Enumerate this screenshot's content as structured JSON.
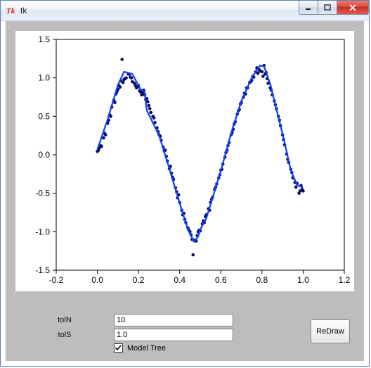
{
  "window": {
    "title": "tk",
    "icon_label": "Tk"
  },
  "controls": {
    "tolN_label": "tolN",
    "tolN_value": "10",
    "tolS_label": "tolS",
    "tolS_value": "1.0",
    "redraw_label": "ReDraw",
    "model_tree_label": "Model Tree",
    "model_tree_checked": true
  },
  "chart_data": {
    "type": "scatter+line",
    "xlabel": "",
    "ylabel": "",
    "xlim": [
      -0.2,
      1.2
    ],
    "ylim": [
      -1.5,
      1.5
    ],
    "xticks": [
      -0.2,
      0.0,
      0.2,
      0.4,
      0.6,
      0.8,
      1.0,
      1.2
    ],
    "yticks": [
      -1.5,
      -1.0,
      -0.5,
      0.0,
      0.5,
      1.0,
      1.5
    ],
    "series": [
      {
        "name": "data",
        "type": "scatter",
        "color": "#0a0a60",
        "points": [
          [
            0.0,
            0.045
          ],
          [
            0.005,
            0.06
          ],
          [
            0.01,
            0.09
          ],
          [
            0.015,
            0.12
          ],
          [
            0.02,
            0.11
          ],
          [
            0.03,
            0.22
          ],
          [
            0.035,
            0.28
          ],
          [
            0.04,
            0.26
          ],
          [
            0.05,
            0.41
          ],
          [
            0.055,
            0.45
          ],
          [
            0.06,
            0.52
          ],
          [
            0.065,
            0.5
          ],
          [
            0.07,
            0.62
          ],
          [
            0.08,
            0.71
          ],
          [
            0.085,
            0.68
          ],
          [
            0.09,
            0.79
          ],
          [
            0.095,
            0.82
          ],
          [
            0.1,
            0.85
          ],
          [
            0.105,
            0.9
          ],
          [
            0.11,
            0.88
          ],
          [
            0.115,
            0.96
          ],
          [
            0.12,
            1.24
          ],
          [
            0.125,
            0.94
          ],
          [
            0.13,
            0.98
          ],
          [
            0.135,
            0.99
          ],
          [
            0.14,
            1.0
          ],
          [
            0.15,
            1.05
          ],
          [
            0.155,
            1.05
          ],
          [
            0.16,
            1.01
          ],
          [
            0.165,
            1.0
          ],
          [
            0.17,
            0.95
          ],
          [
            0.18,
            0.93
          ],
          [
            0.185,
            0.9
          ],
          [
            0.19,
            0.87
          ],
          [
            0.195,
            0.88
          ],
          [
            0.2,
            0.9
          ],
          [
            0.205,
            0.83
          ],
          [
            0.21,
            0.82
          ],
          [
            0.215,
            0.78
          ],
          [
            0.22,
            0.81
          ],
          [
            0.225,
            0.84
          ],
          [
            0.23,
            0.78
          ],
          [
            0.235,
            0.72
          ],
          [
            0.24,
            0.73
          ],
          [
            0.245,
            0.69
          ],
          [
            0.25,
            0.64
          ],
          [
            0.255,
            0.6
          ],
          [
            0.26,
            0.55
          ],
          [
            0.27,
            0.5
          ],
          [
            0.275,
            0.48
          ],
          [
            0.28,
            0.42
          ],
          [
            0.29,
            0.35
          ],
          [
            0.295,
            0.3
          ],
          [
            0.3,
            0.26
          ],
          [
            0.305,
            0.24
          ],
          [
            0.31,
            0.19
          ],
          [
            0.32,
            0.1
          ],
          [
            0.325,
            0.05
          ],
          [
            0.33,
            0.06
          ],
          [
            0.335,
            -0.02
          ],
          [
            0.34,
            -0.08
          ],
          [
            0.35,
            -0.18
          ],
          [
            0.355,
            -0.15
          ],
          [
            0.36,
            -0.24
          ],
          [
            0.365,
            -0.29
          ],
          [
            0.37,
            -0.32
          ],
          [
            0.38,
            -0.43
          ],
          [
            0.385,
            -0.48
          ],
          [
            0.39,
            -0.56
          ],
          [
            0.395,
            -0.52
          ],
          [
            0.4,
            -0.62
          ],
          [
            0.41,
            -0.72
          ],
          [
            0.415,
            -0.78
          ],
          [
            0.42,
            -0.76
          ],
          [
            0.425,
            -0.84
          ],
          [
            0.43,
            -0.88
          ],
          [
            0.44,
            -0.95
          ],
          [
            0.445,
            -0.98
          ],
          [
            0.45,
            -1.0
          ],
          [
            0.455,
            -1.04
          ],
          [
            0.46,
            -1.1
          ],
          [
            0.465,
            -1.3
          ],
          [
            0.47,
            -1.11
          ],
          [
            0.48,
            -1.12
          ],
          [
            0.485,
            -1.05
          ],
          [
            0.49,
            -1.0
          ],
          [
            0.495,
            -0.98
          ],
          [
            0.5,
            -0.99
          ],
          [
            0.51,
            -0.9
          ],
          [
            0.515,
            -0.86
          ],
          [
            0.52,
            -0.88
          ],
          [
            0.525,
            -0.8
          ],
          [
            0.53,
            -0.78
          ],
          [
            0.54,
            -0.7
          ],
          [
            0.545,
            -0.72
          ],
          [
            0.55,
            -0.62
          ],
          [
            0.555,
            -0.58
          ],
          [
            0.56,
            -0.55
          ],
          [
            0.57,
            -0.45
          ],
          [
            0.575,
            -0.42
          ],
          [
            0.58,
            -0.38
          ],
          [
            0.59,
            -0.3
          ],
          [
            0.595,
            -0.26
          ],
          [
            0.6,
            -0.2
          ],
          [
            0.605,
            -0.19
          ],
          [
            0.61,
            -0.12
          ],
          [
            0.62,
            -0.03
          ],
          [
            0.625,
            0.03
          ],
          [
            0.63,
            0.06
          ],
          [
            0.635,
            0.12
          ],
          [
            0.64,
            0.16
          ],
          [
            0.65,
            0.26
          ],
          [
            0.655,
            0.29
          ],
          [
            0.66,
            0.33
          ],
          [
            0.665,
            0.4
          ],
          [
            0.67,
            0.43
          ],
          [
            0.68,
            0.53
          ],
          [
            0.685,
            0.57
          ],
          [
            0.69,
            0.59
          ],
          [
            0.695,
            0.66
          ],
          [
            0.7,
            0.68
          ],
          [
            0.71,
            0.75
          ],
          [
            0.715,
            0.8
          ],
          [
            0.72,
            0.79
          ],
          [
            0.725,
            0.87
          ],
          [
            0.73,
            0.87
          ],
          [
            0.74,
            0.94
          ],
          [
            0.745,
            0.95
          ],
          [
            0.75,
            0.97
          ],
          [
            0.755,
            1.02
          ],
          [
            0.76,
            1.01
          ],
          [
            0.77,
            1.08
          ],
          [
            0.775,
            1.13
          ],
          [
            0.78,
            1.06
          ],
          [
            0.785,
            1.11
          ],
          [
            0.79,
            1.09
          ],
          [
            0.8,
            1.08
          ],
          [
            0.805,
            1.02
          ],
          [
            0.81,
            1.16
          ],
          [
            0.815,
            1.05
          ],
          [
            0.82,
            1.07
          ],
          [
            0.825,
            0.99
          ],
          [
            0.83,
            0.93
          ],
          [
            0.84,
            0.87
          ],
          [
            0.845,
            0.84
          ],
          [
            0.85,
            0.78
          ],
          [
            0.86,
            0.7
          ],
          [
            0.865,
            0.65
          ],
          [
            0.87,
            0.6
          ],
          [
            0.88,
            0.5
          ],
          [
            0.885,
            0.45
          ],
          [
            0.89,
            0.38
          ],
          [
            0.9,
            0.26
          ],
          [
            0.905,
            0.2
          ],
          [
            0.91,
            0.13
          ],
          [
            0.92,
            0.01
          ],
          [
            0.925,
            -0.06
          ],
          [
            0.93,
            -0.1
          ],
          [
            0.94,
            -0.19
          ],
          [
            0.945,
            -0.23
          ],
          [
            0.95,
            -0.3
          ],
          [
            0.96,
            -0.36
          ],
          [
            0.965,
            -0.42
          ],
          [
            0.97,
            -0.37
          ],
          [
            0.98,
            -0.5
          ],
          [
            0.985,
            -0.47
          ],
          [
            0.99,
            -0.4
          ],
          [
            0.995,
            -0.45
          ],
          [
            1.0,
            -0.47
          ]
        ]
      },
      {
        "name": "model-tree-fit",
        "type": "line",
        "color": "#1040ff",
        "points": [
          [
            0.0,
            0.07
          ],
          [
            0.05,
            0.46
          ],
          [
            0.1,
            0.91
          ],
          [
            0.13,
            1.08
          ],
          [
            0.17,
            1.05
          ],
          [
            0.21,
            0.85
          ],
          [
            0.23,
            0.82
          ],
          [
            0.24,
            0.58
          ],
          [
            0.3,
            0.25
          ],
          [
            0.35,
            -0.18
          ],
          [
            0.4,
            -0.63
          ],
          [
            0.44,
            -0.97
          ],
          [
            0.47,
            -1.13
          ],
          [
            0.49,
            -1.06
          ],
          [
            0.5,
            -0.97
          ],
          [
            0.53,
            -0.82
          ],
          [
            0.6,
            -0.21
          ],
          [
            0.65,
            0.28
          ],
          [
            0.7,
            0.7
          ],
          [
            0.75,
            1.0
          ],
          [
            0.79,
            1.16
          ],
          [
            0.81,
            1.15
          ],
          [
            0.84,
            0.92
          ],
          [
            0.9,
            0.27
          ],
          [
            0.94,
            -0.2
          ],
          [
            0.97,
            -0.39
          ],
          [
            1.0,
            -0.43
          ]
        ]
      }
    ]
  }
}
